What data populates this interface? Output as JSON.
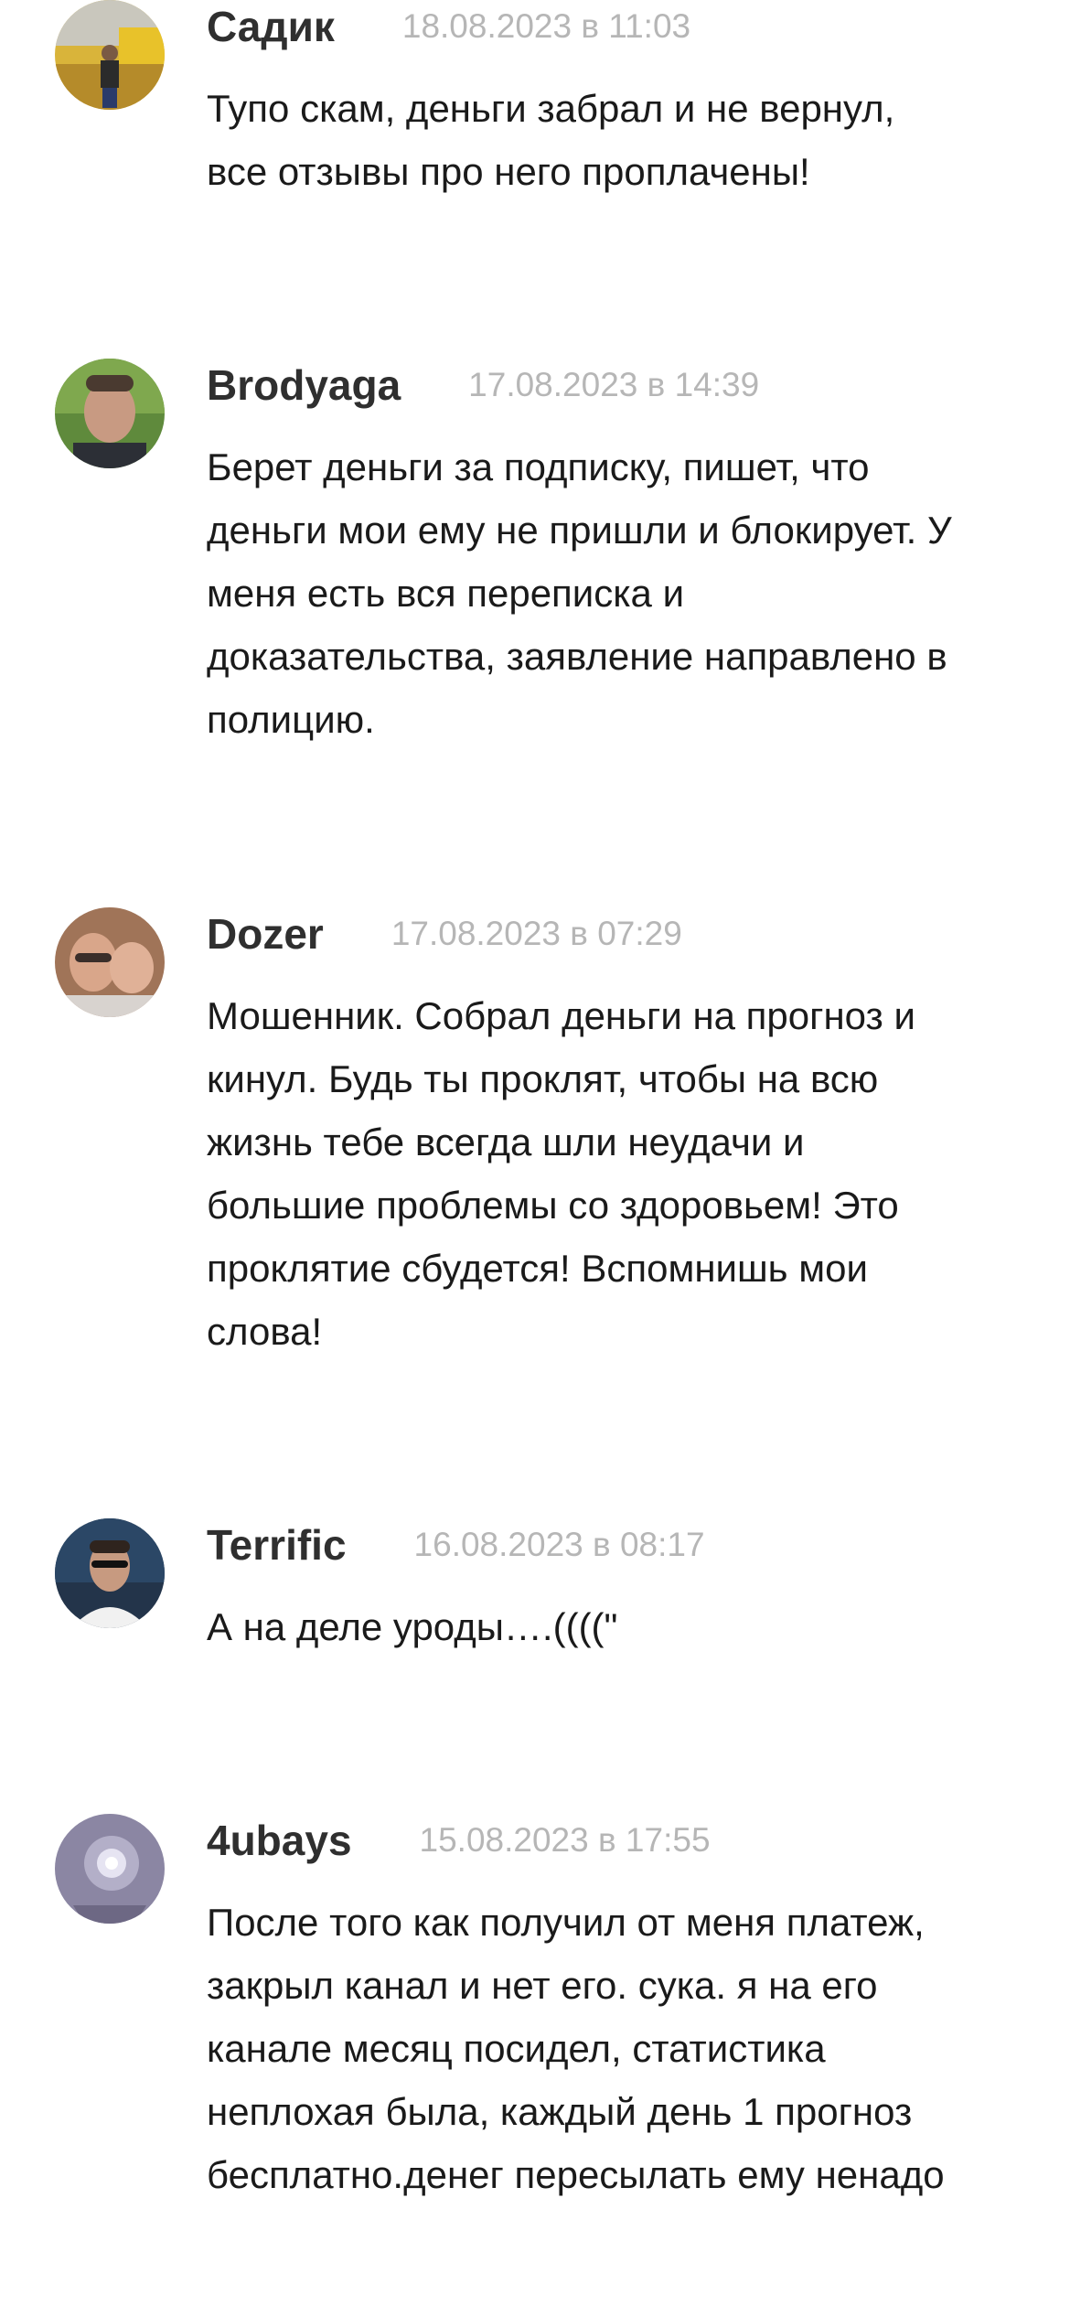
{
  "comments": [
    {
      "author": "Садик",
      "date": "18.08.2023 в 11:03",
      "text": "Тупо скам, деньги забрал и не вернул,\nвсе отзывы про него проплачены!",
      "avatar_icon": "user-photo-avatar"
    },
    {
      "author": "Brodyaga",
      "date": "17.08.2023 в 14:39",
      "text": "Берет деньги за подписку, пишет, что\nденьги мои ему не пришли и блокирует. У\nменя есть вся переписка и\nдоказательства, заявление направлено в\nполицию.",
      "avatar_icon": "user-photo-avatar"
    },
    {
      "author": "Dozer",
      "date": "17.08.2023 в 07:29",
      "text": "Мошенник. Собрал деньги на прогноз и\nкинул. Будь ты проклят, чтобы на всю\nжизнь тебе всегда шли неудачи и\nбольшие проблемы со здоровьем! Это\nпроклятие сбудется! Вспомнишь мои\nслова!",
      "avatar_icon": "user-photo-avatar"
    },
    {
      "author": "Terrific",
      "date": "16.08.2023 в 08:17",
      "text": "А на деле уроды….((((\"",
      "avatar_icon": "user-photo-avatar"
    },
    {
      "author": "4ubays",
      "date": "15.08.2023 в 17:55",
      "text": "После того как получил от меня платеж,\nзакрыл канал и нет его. сука. я на его\nканале месяц посидел, статистика\nнеплохая была, каждый день 1 прогноз\nбесплатно.денег пересылать ему ненадо",
      "avatar_icon": "user-photo-avatar"
    }
  ]
}
